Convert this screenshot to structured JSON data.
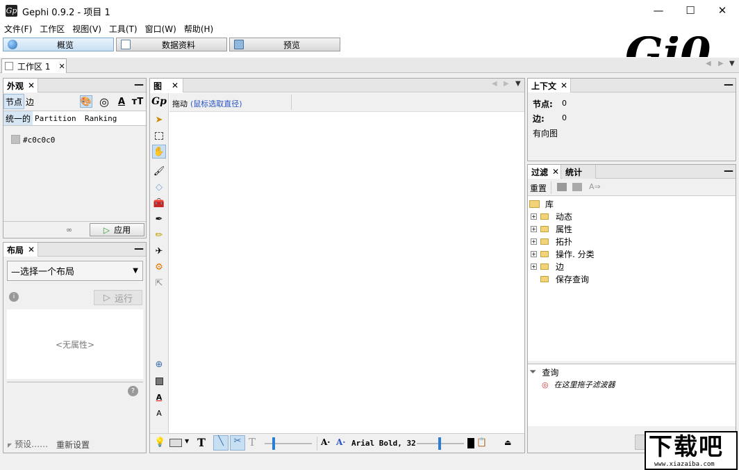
{
  "window": {
    "title": "Gephi 0.9.2 - 项目 1",
    "app_icon": "Gp",
    "minimize": "—",
    "maximize": "☐",
    "close": "✕"
  },
  "menu": [
    "文件(F)",
    "工作区",
    "视图(V)",
    "工具(T)",
    "窗口(W)",
    "帮助(H)"
  ],
  "modes": {
    "overview": "概览",
    "data": "数据资料",
    "preview": "预览"
  },
  "logo": "Gi0",
  "workspace_tab": {
    "label": "工作区 1",
    "close": "✕"
  },
  "appearance": {
    "tab": "外观",
    "close": "✕",
    "minimize": "—",
    "nodes": "节点",
    "edges": "边",
    "unique": "统一的",
    "partition": "Partition",
    "ranking": "Ranking",
    "color_value": "#c0c0c0",
    "apply": "应用",
    "apply_icon": "▷",
    "link_icon": "∞",
    "icons": {
      "palette": "🎨",
      "size": "◎",
      "label_color": "A",
      "label_size": "тT"
    }
  },
  "layout": {
    "tab": "布局",
    "close": "✕",
    "minimize": "—",
    "select": "—选择一个布局",
    "run": "运行",
    "run_icon": "▷",
    "no_props": "<无属性>",
    "presets": "预设……",
    "reset": "重新设置",
    "info": "i",
    "help": "?"
  },
  "graph": {
    "tab": "图",
    "close": "✕",
    "mode_label": "拖动",
    "hint": "(鼠标选取直径)",
    "font_label": "Arial Bold, 32",
    "nav_left": "◀",
    "nav_right": "▶",
    "nav_menu": "▼"
  },
  "context": {
    "tab": "上下文",
    "close": "✕",
    "minimize": "—",
    "nodes_label": "节点:",
    "nodes_value": "0",
    "edges_label": "边:",
    "edges_value": "0",
    "graph_type": "有向图"
  },
  "filters": {
    "tab": "过滤",
    "stats_tab": "统计",
    "close": "✕",
    "minimize": "—",
    "reset": "重置",
    "library": "库",
    "items": [
      "动态",
      "属性",
      "拓扑",
      "操作. 分类",
      "边"
    ],
    "save_query": "保存查询",
    "query": "查询",
    "drop_hint": "在这里拖子滤波器"
  },
  "watermark": "下载吧",
  "watermark_url": "www.xiazaiba.com"
}
